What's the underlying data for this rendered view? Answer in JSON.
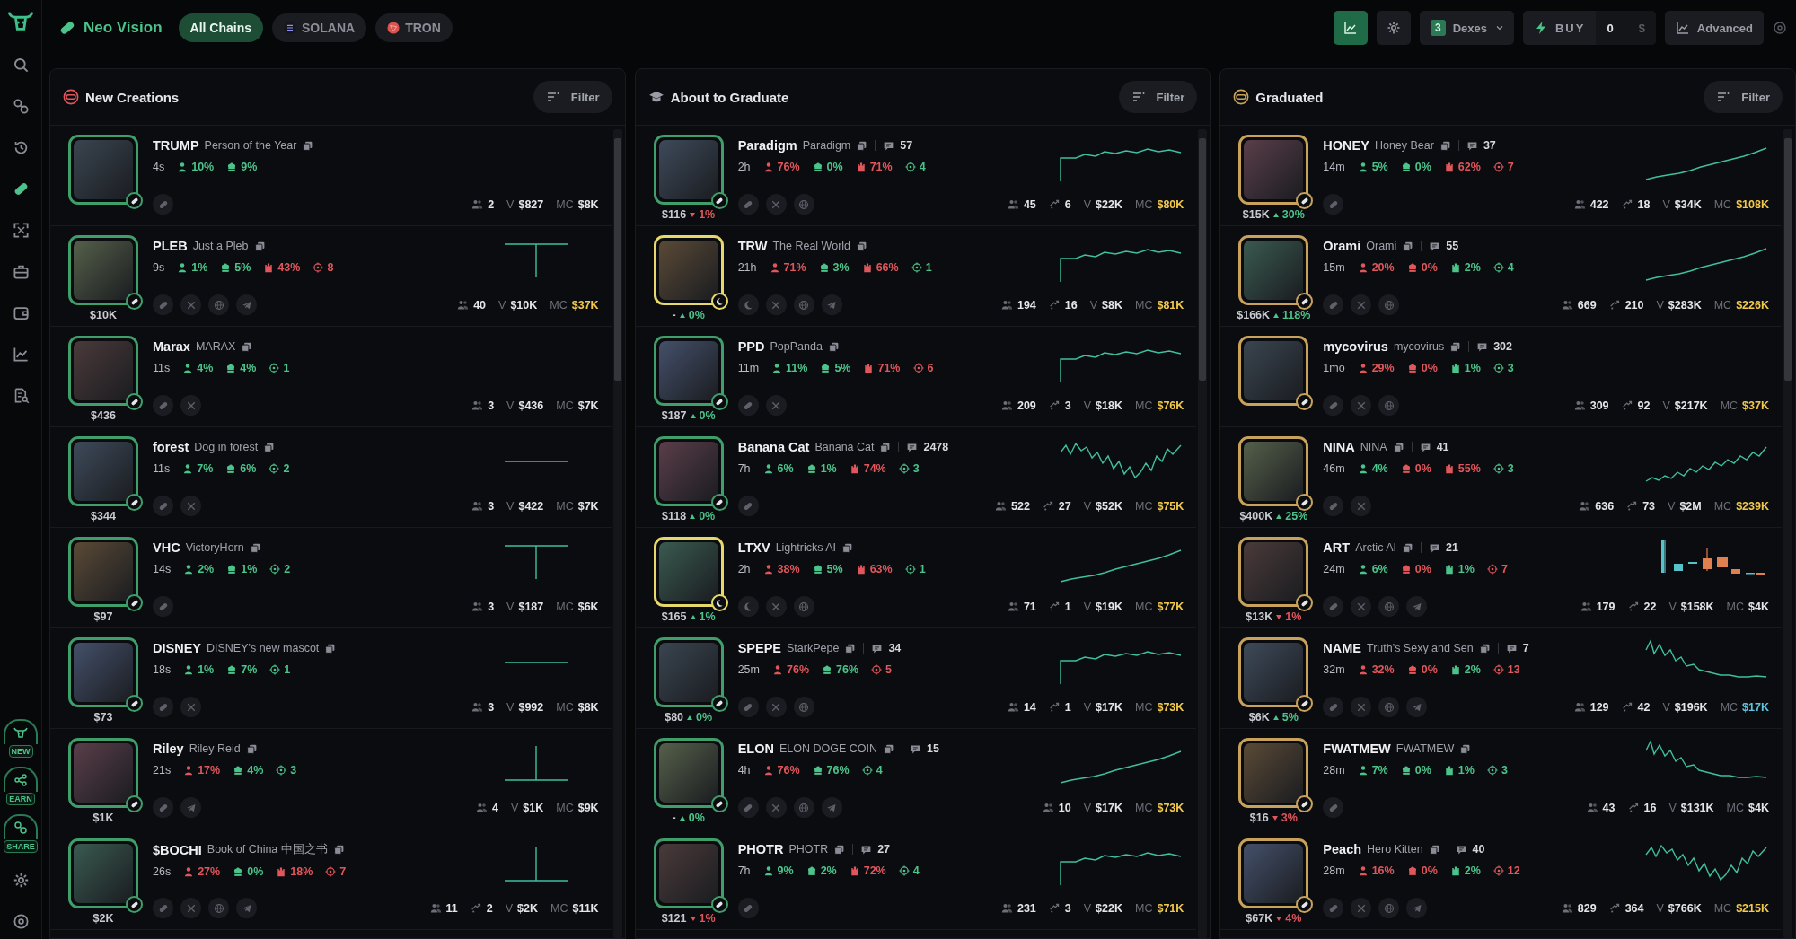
{
  "header": {
    "brand": "Neo Vision",
    "chains": [
      {
        "label": "All Chains",
        "selected": true
      },
      {
        "label": "SOLANA",
        "selected": false
      },
      {
        "label": "TRON",
        "selected": false
      }
    ],
    "chart_toggle": {
      "on": true
    },
    "dexes": {
      "count": "3",
      "label": "Dexes"
    },
    "buy": {
      "label": "BUY",
      "amount": "0",
      "unit": "$"
    },
    "advanced": "Advanced"
  },
  "sidebar": {
    "items": [
      {
        "selected": false
      },
      {
        "selected": false
      },
      {
        "selected": false
      },
      {
        "selected": true
      },
      {
        "selected": false
      },
      {
        "selected": false
      },
      {
        "selected": false
      },
      {
        "selected": false
      },
      {
        "selected": false
      }
    ],
    "promos": [
      {
        "label": "NEW"
      },
      {
        "label": "EARN"
      },
      {
        "label": "SHARE"
      }
    ]
  },
  "columns": [
    {
      "title": "New Creations",
      "filter": "Filter",
      "tokens": [
        {
          "symbol": "TRUMP",
          "name": "Person of the Year",
          "age": "4s",
          "stats": [
            {
              "kind": "holders",
              "text": "10%",
              "color": "#4cc38a"
            },
            {
              "kind": "dev",
              "text": "9%",
              "color": "#4cc38a"
            }
          ],
          "socials": [
            {
              "kind": "pill"
            }
          ],
          "avatar": {
            "color": "#3f9e6a",
            "kind": "pill"
          },
          "holders": "2",
          "volume": {
            "label": "V",
            "text": "$827"
          },
          "mc": {
            "label": "MC",
            "text": "$8K",
            "color": "#e6e6e9"
          }
        },
        {
          "symbol": "PLEB",
          "name": "Just a Pleb",
          "age": "9s",
          "stats": [
            {
              "kind": "holders",
              "text": "1%",
              "color": "#4cc38a"
            },
            {
              "kind": "dev",
              "text": "5%",
              "color": "#4cc38a"
            },
            {
              "kind": "top",
              "text": "43%",
              "color": "#e0565b"
            },
            {
              "kind": "snipers",
              "text": "8",
              "color": "#e0565b"
            }
          ],
          "socials": [
            {
              "kind": "pill"
            },
            {
              "kind": "x"
            },
            {
              "kind": "web"
            },
            {
              "kind": "telegram"
            }
          ],
          "avatar": {
            "color": "#3f9e6a",
            "kind": "pill"
          },
          "price": "$10K",
          "holders": "40",
          "volume": {
            "label": "V",
            "text": "$10K"
          },
          "mc": {
            "label": "MC",
            "text": "$37K",
            "color": "#f2c94c"
          },
          "spark": {
            "kind": "t"
          }
        },
        {
          "symbol": "Marax",
          "name": "MARAX",
          "age": "11s",
          "stats": [
            {
              "kind": "holders",
              "text": "4%",
              "color": "#4cc38a"
            },
            {
              "kind": "dev",
              "text": "4%",
              "color": "#4cc38a"
            },
            {
              "kind": "snipers",
              "text": "1",
              "color": "#4cc38a"
            }
          ],
          "socials": [
            {
              "kind": "pill"
            },
            {
              "kind": "x"
            }
          ],
          "avatar": {
            "color": "#3f9e6a",
            "kind": "pill"
          },
          "price": "$436",
          "holders": "3",
          "volume": {
            "label": "V",
            "text": "$436"
          },
          "mc": {
            "label": "MC",
            "text": "$7K",
            "color": "#e6e6e9"
          }
        },
        {
          "symbol": "forest",
          "name": "Dog in forest",
          "age": "11s",
          "stats": [
            {
              "kind": "holders",
              "text": "7%",
              "color": "#4cc38a"
            },
            {
              "kind": "dev",
              "text": "6%",
              "color": "#4cc38a"
            },
            {
              "kind": "snipers",
              "text": "2",
              "color": "#4cc38a"
            }
          ],
          "socials": [
            {
              "kind": "pill"
            },
            {
              "kind": "x"
            }
          ],
          "avatar": {
            "color": "#3f9e6a",
            "kind": "pill"
          },
          "price": "$344",
          "holders": "3",
          "volume": {
            "label": "V",
            "text": "$422"
          },
          "mc": {
            "label": "MC",
            "text": "$7K",
            "color": "#e6e6e9"
          },
          "spark": {
            "kind": "line"
          }
        },
        {
          "symbol": "VHC",
          "name": "VictoryHorn",
          "age": "14s",
          "stats": [
            {
              "kind": "holders",
              "text": "2%",
              "color": "#4cc38a"
            },
            {
              "kind": "dev",
              "text": "1%",
              "color": "#4cc38a"
            },
            {
              "kind": "snipers",
              "text": "2",
              "color": "#4cc38a"
            }
          ],
          "socials": [
            {
              "kind": "pill"
            }
          ],
          "avatar": {
            "color": "#3f9e6a",
            "kind": "pill"
          },
          "price": "$97",
          "holders": "3",
          "volume": {
            "label": "V",
            "text": "$187"
          },
          "mc": {
            "label": "MC",
            "text": "$6K",
            "color": "#e6e6e9"
          },
          "spark": {
            "kind": "t"
          }
        },
        {
          "symbol": "DISNEY",
          "name": "DISNEY's new mascot",
          "age": "18s",
          "stats": [
            {
              "kind": "holders",
              "text": "1%",
              "color": "#4cc38a"
            },
            {
              "kind": "dev",
              "text": "7%",
              "color": "#4cc38a"
            },
            {
              "kind": "snipers",
              "text": "1",
              "color": "#4cc38a"
            }
          ],
          "socials": [
            {
              "kind": "pill"
            },
            {
              "kind": "x"
            }
          ],
          "avatar": {
            "color": "#3f9e6a",
            "kind": "pill"
          },
          "price": "$73",
          "holders": "3",
          "volume": {
            "label": "V",
            "text": "$992"
          },
          "mc": {
            "label": "MC",
            "text": "$8K",
            "color": "#e6e6e9"
          },
          "spark": {
            "kind": "line"
          }
        },
        {
          "symbol": "Riley",
          "name": "Riley Reid",
          "age": "21s",
          "stats": [
            {
              "kind": "holders",
              "text": "17%",
              "color": "#e0565b"
            },
            {
              "kind": "dev",
              "text": "4%",
              "color": "#4cc38a"
            },
            {
              "kind": "snipers",
              "text": "3",
              "color": "#4cc38a"
            }
          ],
          "socials": [
            {
              "kind": "pill"
            },
            {
              "kind": "telegram"
            }
          ],
          "avatar": {
            "color": "#3f9e6a",
            "kind": "pill"
          },
          "price": "$1K",
          "holders": "4",
          "volume": {
            "label": "V",
            "text": "$1K"
          },
          "mc": {
            "label": "MC",
            "text": "$9K",
            "color": "#e6e6e9"
          },
          "spark": {
            "kind": "inv_t"
          }
        },
        {
          "symbol": "$BOCHI",
          "name": "Book of China 中国之书",
          "age": "26s",
          "stats": [
            {
              "kind": "holders",
              "text": "27%",
              "color": "#e0565b"
            },
            {
              "kind": "dev",
              "text": "0%",
              "color": "#4cc38a"
            },
            {
              "kind": "top",
              "text": "18%",
              "color": "#e0565b"
            },
            {
              "kind": "snipers",
              "text": "7",
              "color": "#e0565b"
            }
          ],
          "socials": [
            {
              "kind": "pill"
            },
            {
              "kind": "x"
            },
            {
              "kind": "web"
            },
            {
              "kind": "telegram"
            }
          ],
          "avatar": {
            "color": "#3f9e6a",
            "kind": "pill"
          },
          "price": "$2K",
          "holders": "11",
          "txns": "2",
          "volume": {
            "label": "V",
            "text": "$2K"
          },
          "mc": {
            "label": "MC",
            "text": "$11K",
            "color": "#e6e6e9"
          },
          "spark": {
            "kind": "inv_t"
          }
        }
      ]
    },
    {
      "title": "About to Graduate",
      "filter": "Filter",
      "tokens": [
        {
          "symbol": "Paradigm",
          "name": "Paradigm",
          "comments": "57",
          "age": "2h",
          "stats": [
            {
              "kind": "holders",
              "text": "76%",
              "color": "#e0565b"
            },
            {
              "kind": "dev",
              "text": "0%",
              "color": "#4cc38a"
            },
            {
              "kind": "top",
              "text": "71%",
              "color": "#e0565b"
            },
            {
              "kind": "snipers",
              "text": "4",
              "color": "#4cc38a"
            }
          ],
          "socials": [
            {
              "kind": "pill"
            },
            {
              "kind": "x"
            },
            {
              "kind": "web"
            }
          ],
          "avatar": {
            "color": "#3f9e6a",
            "kind": "pill"
          },
          "price": "$116",
          "change": {
            "text": "1%",
            "kind": "down"
          },
          "holders": "45",
          "txns": "6",
          "volume": {
            "label": "V",
            "text": "$22K"
          },
          "mc": {
            "label": "MC",
            "text": "$80K",
            "color": "#f2c94c"
          },
          "spark": {
            "kind": "step"
          }
        },
        {
          "symbol": "TRW",
          "name": "The Real World",
          "age": "21h",
          "stats": [
            {
              "kind": "holders",
              "text": "71%",
              "color": "#e0565b"
            },
            {
              "kind": "dev",
              "text": "3%",
              "color": "#4cc38a"
            },
            {
              "kind": "top",
              "text": "66%",
              "color": "#e0565b"
            },
            {
              "kind": "snipers",
              "text": "1",
              "color": "#4cc38a"
            }
          ],
          "socials": [
            {
              "kind": "moon"
            },
            {
              "kind": "x"
            },
            {
              "kind": "web"
            },
            {
              "kind": "telegram"
            }
          ],
          "avatar": {
            "color": "#e6d86a",
            "kind": "moon"
          },
          "price": "-",
          "change": {
            "text": "0%",
            "kind": "up"
          },
          "holders": "194",
          "txns": "16",
          "volume": {
            "label": "V",
            "text": "$8K"
          },
          "mc": {
            "label": "MC",
            "text": "$81K",
            "color": "#f2c94c"
          },
          "spark": {
            "kind": "step"
          }
        },
        {
          "symbol": "PPD",
          "name": "PopPanda",
          "age": "11m",
          "stats": [
            {
              "kind": "holders",
              "text": "11%",
              "color": "#4cc38a"
            },
            {
              "kind": "dev",
              "text": "5%",
              "color": "#4cc38a"
            },
            {
              "kind": "top",
              "text": "71%",
              "color": "#e0565b"
            },
            {
              "kind": "snipers",
              "text": "6",
              "color": "#e0565b"
            }
          ],
          "socials": [
            {
              "kind": "pill"
            },
            {
              "kind": "x"
            }
          ],
          "avatar": {
            "color": "#3f9e6a",
            "kind": "pill"
          },
          "price": "$187",
          "change": {
            "text": "0%",
            "kind": "up"
          },
          "holders": "209",
          "txns": "3",
          "volume": {
            "label": "V",
            "text": "$18K"
          },
          "mc": {
            "label": "MC",
            "text": "$76K",
            "color": "#f2c94c"
          },
          "spark": {
            "kind": "step"
          }
        },
        {
          "symbol": "Banana Cat",
          "name": "Banana Cat",
          "comments": "2478",
          "age": "7h",
          "stats": [
            {
              "kind": "holders",
              "text": "6%",
              "color": "#4cc38a"
            },
            {
              "kind": "dev",
              "text": "1%",
              "color": "#4cc38a"
            },
            {
              "kind": "top",
              "text": "74%",
              "color": "#e0565b"
            },
            {
              "kind": "snipers",
              "text": "3",
              "color": "#4cc38a"
            }
          ],
          "socials": [
            {
              "kind": "pill"
            }
          ],
          "avatar": {
            "color": "#3f9e6a",
            "kind": "pill"
          },
          "price": "$118",
          "change": {
            "text": "0%",
            "kind": "up"
          },
          "holders": "522",
          "txns": "27",
          "volume": {
            "label": "V",
            "text": "$52K"
          },
          "mc": {
            "label": "MC",
            "text": "$75K",
            "color": "#f2c94c"
          },
          "spark": {
            "kind": "volatile"
          }
        },
        {
          "symbol": "LTXV",
          "name": "Lightricks AI",
          "age": "2h",
          "stats": [
            {
              "kind": "holders",
              "text": "38%",
              "color": "#e0565b"
            },
            {
              "kind": "dev",
              "text": "5%",
              "color": "#4cc38a"
            },
            {
              "kind": "top",
              "text": "63%",
              "color": "#e0565b"
            },
            {
              "kind": "snipers",
              "text": "1",
              "color": "#4cc38a"
            }
          ],
          "socials": [
            {
              "kind": "moon"
            },
            {
              "kind": "x"
            },
            {
              "kind": "web"
            }
          ],
          "avatar": {
            "color": "#e6d86a",
            "kind": "moon"
          },
          "price": "$165",
          "change": {
            "text": "1%",
            "kind": "up"
          },
          "holders": "71",
          "txns": "1",
          "volume": {
            "label": "V",
            "text": "$19K"
          },
          "mc": {
            "label": "MC",
            "text": "$77K",
            "color": "#f2c94c"
          },
          "spark": {
            "kind": "rise"
          }
        },
        {
          "symbol": "SPEPE",
          "name": "StarkPepe",
          "comments": "34",
          "age": "25m",
          "stats": [
            {
              "kind": "holders",
              "text": "76%",
              "color": "#e0565b"
            },
            {
              "kind": "dev",
              "text": "76%",
              "color": "#4cc38a"
            },
            {
              "kind": "snipers",
              "text": "5",
              "color": "#e0565b"
            }
          ],
          "socials": [
            {
              "kind": "pill"
            },
            {
              "kind": "x"
            },
            {
              "kind": "web"
            }
          ],
          "avatar": {
            "color": "#3f9e6a",
            "kind": "pill"
          },
          "price": "$80",
          "change": {
            "text": "0%",
            "kind": "up"
          },
          "holders": "14",
          "txns": "1",
          "volume": {
            "label": "V",
            "text": "$17K"
          },
          "mc": {
            "label": "MC",
            "text": "$73K",
            "color": "#f2c94c"
          },
          "spark": {
            "kind": "step"
          }
        },
        {
          "symbol": "ELON",
          "name": "ELON DOGE COIN",
          "comments": "15",
          "age": "4h",
          "stats": [
            {
              "kind": "holders",
              "text": "76%",
              "color": "#e0565b"
            },
            {
              "kind": "dev",
              "text": "76%",
              "color": "#4cc38a"
            },
            {
              "kind": "snipers",
              "text": "4",
              "color": "#4cc38a"
            }
          ],
          "socials": [
            {
              "kind": "pill"
            },
            {
              "kind": "x"
            },
            {
              "kind": "web"
            },
            {
              "kind": "telegram"
            }
          ],
          "avatar": {
            "color": "#3f9e6a",
            "kind": "pill"
          },
          "price": "-",
          "change": {
            "text": "0%",
            "kind": "up"
          },
          "holders": "10",
          "volume": {
            "label": "V",
            "text": "$17K"
          },
          "mc": {
            "label": "MC",
            "text": "$73K",
            "color": "#f2c94c"
          },
          "spark": {
            "kind": "rise"
          }
        },
        {
          "symbol": "PHOTR",
          "name": "PHOTR",
          "comments": "27",
          "age": "7h",
          "stats": [
            {
              "kind": "holders",
              "text": "9%",
              "color": "#4cc38a"
            },
            {
              "kind": "dev",
              "text": "2%",
              "color": "#4cc38a"
            },
            {
              "kind": "top",
              "text": "72%",
              "color": "#e0565b"
            },
            {
              "kind": "snipers",
              "text": "4",
              "color": "#4cc38a"
            }
          ],
          "socials": [
            {
              "kind": "pill"
            }
          ],
          "avatar": {
            "color": "#3f9e6a",
            "kind": "pill"
          },
          "price": "$121",
          "change": {
            "text": "1%",
            "kind": "down"
          },
          "holders": "231",
          "txns": "3",
          "volume": {
            "label": "V",
            "text": "$22K"
          },
          "mc": {
            "label": "MC",
            "text": "$71K",
            "color": "#f2c94c"
          },
          "spark": {
            "kind": "step"
          }
        }
      ]
    },
    {
      "title": "Graduated",
      "filter": "Filter",
      "tokens": [
        {
          "symbol": "HONEY",
          "name": "Honey Bear",
          "comments": "37",
          "age": "14m",
          "stats": [
            {
              "kind": "holders",
              "text": "5%",
              "color": "#4cc38a"
            },
            {
              "kind": "dev",
              "text": "0%",
              "color": "#4cc38a"
            },
            {
              "kind": "top",
              "text": "62%",
              "color": "#e0565b"
            },
            {
              "kind": "snipers",
              "text": "7",
              "color": "#e0565b"
            }
          ],
          "socials": [
            {
              "kind": "pill"
            }
          ],
          "avatar": {
            "color": "#c8a25a",
            "kind": "pill"
          },
          "price": "$15K",
          "change": {
            "text": "30%",
            "kind": "up"
          },
          "holders": "422",
          "txns": "18",
          "volume": {
            "label": "V",
            "text": "$34K"
          },
          "mc": {
            "label": "MC",
            "text": "$108K",
            "color": "#f2c94c"
          },
          "spark": {
            "kind": "rise"
          }
        },
        {
          "symbol": "Orami",
          "name": "Orami",
          "comments": "55",
          "age": "15m",
          "stats": [
            {
              "kind": "holders",
              "text": "20%",
              "color": "#e0565b"
            },
            {
              "kind": "dev",
              "text": "0%",
              "color": "#e0565b"
            },
            {
              "kind": "top",
              "text": "2%",
              "color": "#4cc38a"
            },
            {
              "kind": "snipers",
              "text": "4",
              "color": "#4cc38a"
            }
          ],
          "socials": [
            {
              "kind": "pill"
            },
            {
              "kind": "x"
            },
            {
              "kind": "web"
            }
          ],
          "avatar": {
            "color": "#c8a25a",
            "kind": "pill"
          },
          "price": "$166K",
          "change": {
            "text": "118%",
            "kind": "up"
          },
          "holders": "669",
          "txns": "210",
          "volume": {
            "label": "V",
            "text": "$283K"
          },
          "mc": {
            "label": "MC",
            "text": "$226K",
            "color": "#f2c94c"
          },
          "spark": {
            "kind": "rise"
          }
        },
        {
          "symbol": "mycovirus",
          "name": "mycovirus",
          "comments": "302",
          "age": "1mo",
          "stats": [
            {
              "kind": "holders",
              "text": "29%",
              "color": "#e0565b"
            },
            {
              "kind": "dev",
              "text": "0%",
              "color": "#e0565b"
            },
            {
              "kind": "top",
              "text": "1%",
              "color": "#4cc38a"
            },
            {
              "kind": "snipers",
              "text": "3",
              "color": "#4cc38a"
            }
          ],
          "socials": [
            {
              "kind": "pill"
            },
            {
              "kind": "x"
            },
            {
              "kind": "web"
            }
          ],
          "avatar": {
            "color": "#c8a25a",
            "kind": "pill"
          },
          "holders": "309",
          "txns": "92",
          "volume": {
            "label": "V",
            "text": "$217K"
          },
          "mc": {
            "label": "MC",
            "text": "$37K",
            "color": "#f2c94c"
          }
        },
        {
          "symbol": "NINA",
          "name": "NINA",
          "comments": "41",
          "age": "46m",
          "stats": [
            {
              "kind": "holders",
              "text": "4%",
              "color": "#4cc38a"
            },
            {
              "kind": "dev",
              "text": "0%",
              "color": "#e0565b"
            },
            {
              "kind": "top",
              "text": "55%",
              "color": "#e0565b"
            },
            {
              "kind": "snipers",
              "text": "3",
              "color": "#4cc38a"
            }
          ],
          "socials": [
            {
              "kind": "pill"
            },
            {
              "kind": "x"
            }
          ],
          "avatar": {
            "color": "#c8a25a",
            "kind": "pill"
          },
          "price": "$400K",
          "change": {
            "text": "25%",
            "kind": "up"
          },
          "holders": "636",
          "txns": "73",
          "volume": {
            "label": "V",
            "text": "$2M"
          },
          "mc": {
            "label": "MC",
            "text": "$239K",
            "color": "#f2c94c"
          },
          "spark": {
            "kind": "climb"
          }
        },
        {
          "symbol": "ART",
          "name": "Arctic AI",
          "comments": "21",
          "age": "24m",
          "stats": [
            {
              "kind": "holders",
              "text": "6%",
              "color": "#4cc38a"
            },
            {
              "kind": "dev",
              "text": "0%",
              "color": "#e0565b"
            },
            {
              "kind": "top",
              "text": "1%",
              "color": "#4cc38a"
            },
            {
              "kind": "snipers",
              "text": "7",
              "color": "#e0565b"
            }
          ],
          "socials": [
            {
              "kind": "pill"
            },
            {
              "kind": "x"
            },
            {
              "kind": "web"
            },
            {
              "kind": "telegram"
            }
          ],
          "avatar": {
            "color": "#c8a25a",
            "kind": "pill"
          },
          "price": "$13K",
          "change": {
            "text": "1%",
            "kind": "down"
          },
          "holders": "179",
          "txns": "22",
          "volume": {
            "label": "V",
            "text": "$158K"
          },
          "mc": {
            "label": "MC",
            "text": "$4K",
            "color": "#e6e6e9"
          },
          "spark": {
            "kind": "bars"
          }
        },
        {
          "symbol": "NAME",
          "name": "Truth's Sexy and Sen",
          "comments": "7",
          "age": "32m",
          "stats": [
            {
              "kind": "holders",
              "text": "32%",
              "color": "#e0565b"
            },
            {
              "kind": "dev",
              "text": "0%",
              "color": "#e0565b"
            },
            {
              "kind": "top",
              "text": "2%",
              "color": "#4cc38a"
            },
            {
              "kind": "snipers",
              "text": "13",
              "color": "#e0565b"
            }
          ],
          "socials": [
            {
              "kind": "pill"
            },
            {
              "kind": "x"
            },
            {
              "kind": "web"
            },
            {
              "kind": "telegram"
            }
          ],
          "avatar": {
            "color": "#c8a25a",
            "kind": "pill"
          },
          "price": "$6K",
          "change": {
            "text": "5%",
            "kind": "up"
          },
          "holders": "129",
          "txns": "42",
          "volume": {
            "label": "V",
            "text": "$196K"
          },
          "mc": {
            "label": "MC",
            "text": "$17K",
            "color": "#5fc4dc"
          },
          "spark": {
            "kind": "fall"
          }
        },
        {
          "symbol": "FWATMEW",
          "name": "FWATMEW",
          "age": "28m",
          "stats": [
            {
              "kind": "holders",
              "text": "7%",
              "color": "#4cc38a"
            },
            {
              "kind": "dev",
              "text": "0%",
              "color": "#4cc38a"
            },
            {
              "kind": "top",
              "text": "1%",
              "color": "#4cc38a"
            },
            {
              "kind": "snipers",
              "text": "3",
              "color": "#4cc38a"
            }
          ],
          "socials": [
            {
              "kind": "pill"
            }
          ],
          "avatar": {
            "color": "#c8a25a",
            "kind": "pill"
          },
          "price": "$16",
          "change": {
            "text": "3%",
            "kind": "down"
          },
          "holders": "43",
          "txns": "16",
          "volume": {
            "label": "V",
            "text": "$131K"
          },
          "mc": {
            "label": "MC",
            "text": "$4K",
            "color": "#e6e6e9"
          },
          "spark": {
            "kind": "fall"
          }
        },
        {
          "symbol": "Peach",
          "name": "Hero Kitten",
          "comments": "40",
          "age": "28m",
          "stats": [
            {
              "kind": "holders",
              "text": "16%",
              "color": "#e0565b"
            },
            {
              "kind": "dev",
              "text": "0%",
              "color": "#e0565b"
            },
            {
              "kind": "top",
              "text": "2%",
              "color": "#4cc38a"
            },
            {
              "kind": "snipers",
              "text": "12",
              "color": "#e0565b"
            }
          ],
          "socials": [
            {
              "kind": "pill"
            },
            {
              "kind": "x"
            },
            {
              "kind": "web"
            },
            {
              "kind": "telegram"
            }
          ],
          "avatar": {
            "color": "#c8a25a",
            "kind": "pill"
          },
          "price": "$67K",
          "change": {
            "text": "4%",
            "kind": "down"
          },
          "holders": "829",
          "txns": "364",
          "volume": {
            "label": "V",
            "text": "$766K"
          },
          "mc": {
            "label": "MC",
            "text": "$215K",
            "color": "#f2c94c"
          },
          "spark": {
            "kind": "volatile"
          }
        }
      ]
    }
  ]
}
